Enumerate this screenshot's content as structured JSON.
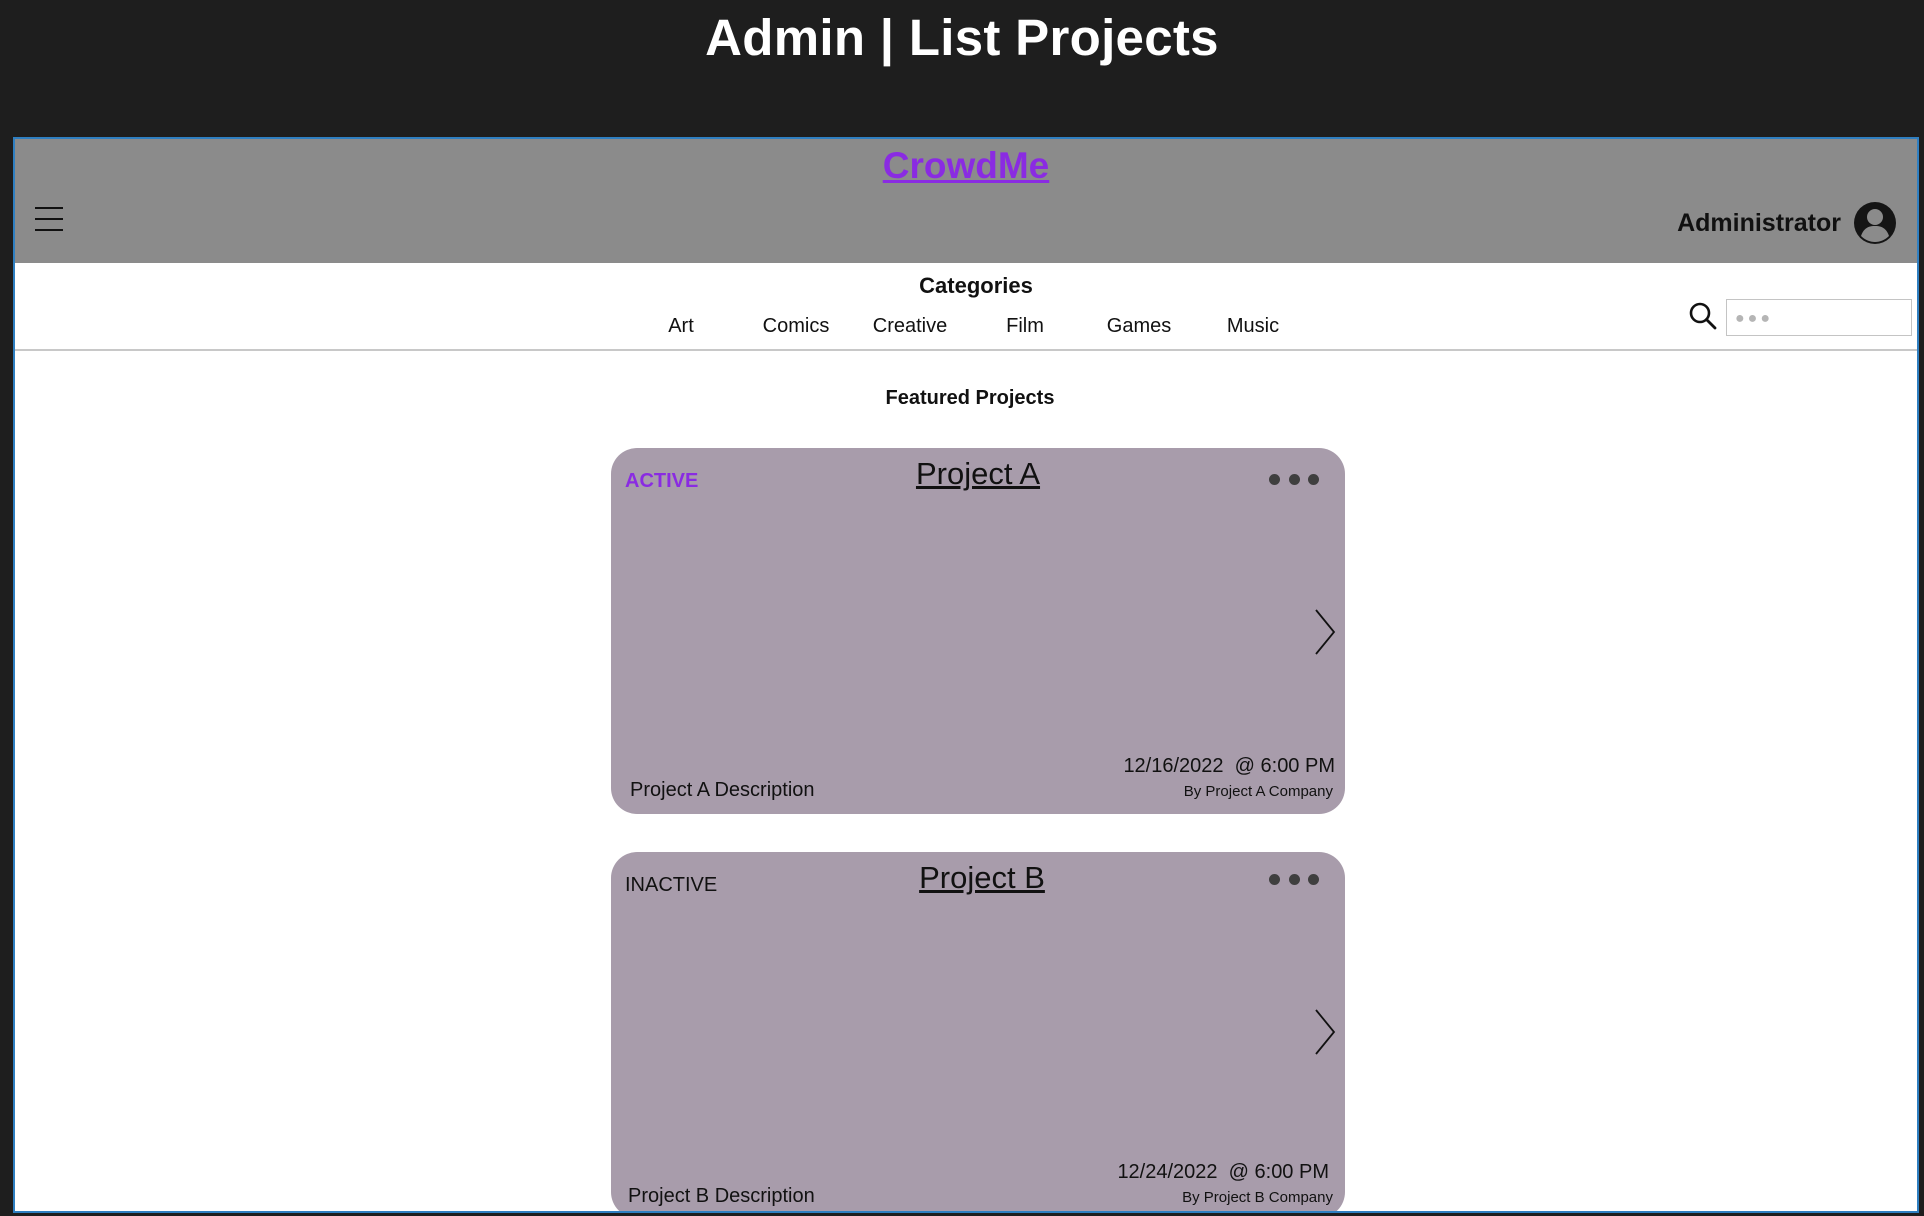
{
  "page": {
    "title": "Admin | List Projects"
  },
  "header": {
    "brand": "CrowdMe",
    "menu_icon": "hamburger-menu-icon",
    "user_name": "Administrator",
    "user_icon": "user-avatar-icon"
  },
  "categories": {
    "title": "Categories",
    "items": [
      "Art",
      "Comics",
      "Creative",
      "Film",
      "Games",
      "Music"
    ]
  },
  "search": {
    "placeholder": "●●●",
    "icon": "search-icon"
  },
  "featured": {
    "title": "Featured Projects"
  },
  "projects": [
    {
      "status": "ACTIVE",
      "title": "Project A",
      "description": "Project A Description",
      "datetime": "12/16/2022  @ 6:00 PM",
      "company": "By Project A Company"
    },
    {
      "status": "INACTIVE",
      "title": "Project B",
      "description": "Project B Description",
      "datetime": "12/24/2022  @ 6:00 PM",
      "company": "By Project B Company"
    }
  ],
  "colors": {
    "brand": "#8a2be2",
    "topbar": "#8b8b8b",
    "card": "#a89cab",
    "page_bg": "#1e1e1e",
    "frame_border": "#2f7fc1"
  }
}
